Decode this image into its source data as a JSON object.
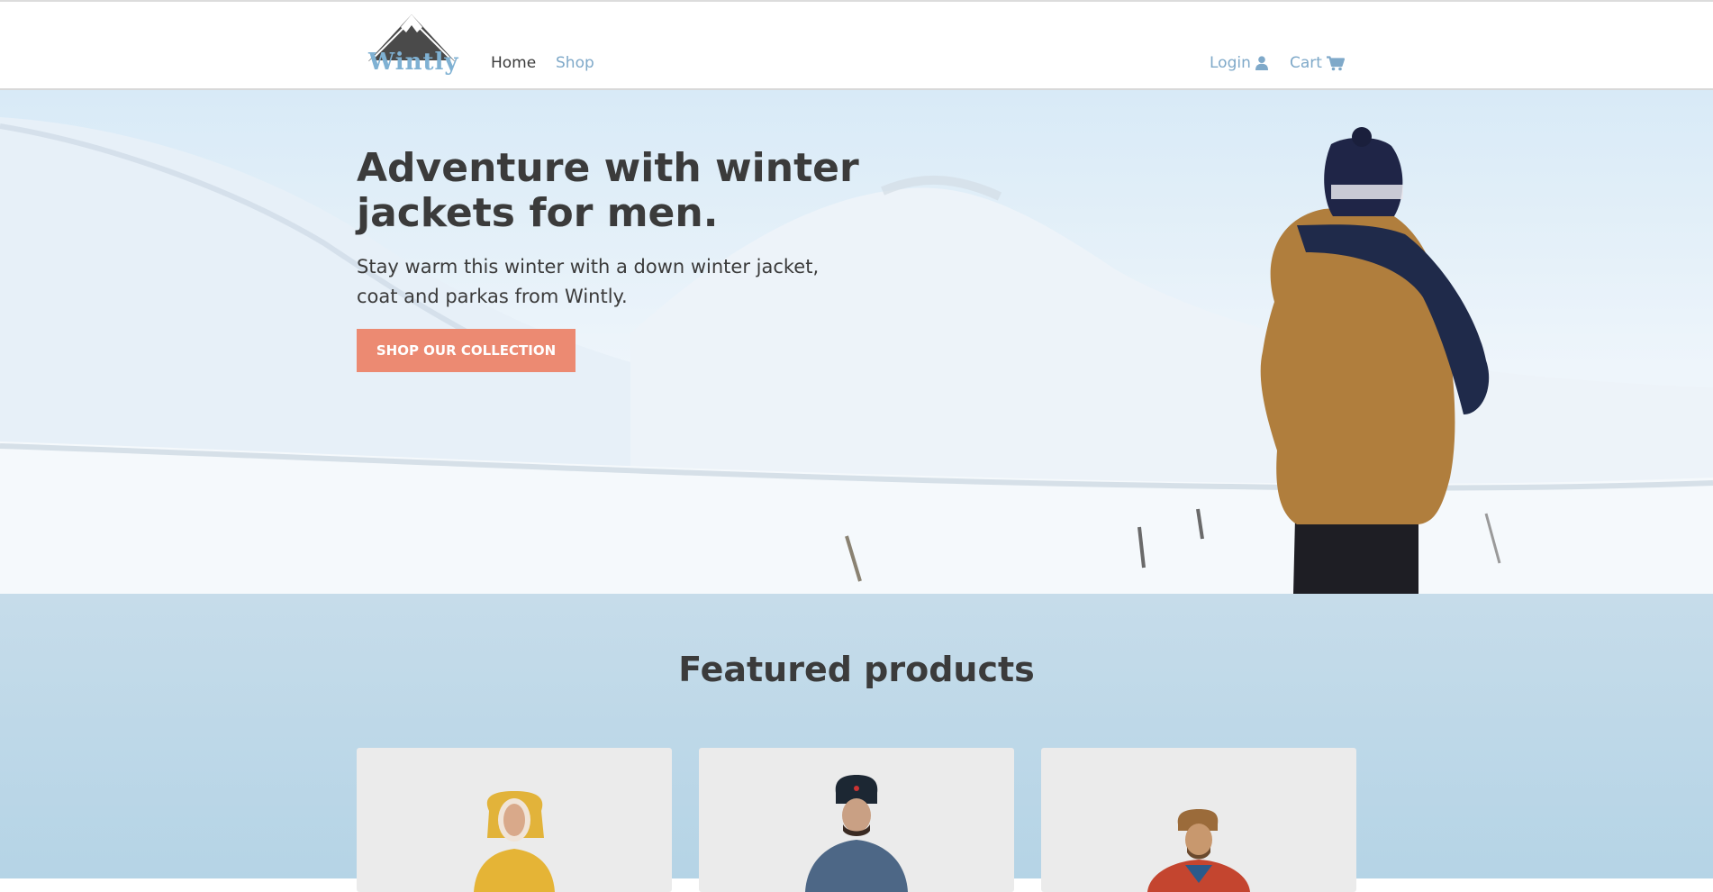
{
  "brand": {
    "name": "Wintly"
  },
  "nav": {
    "home": "Home",
    "shop": "Shop",
    "login": "Login",
    "cart": "Cart"
  },
  "icons": {
    "login": "user-icon",
    "cart": "shopping-cart-icon"
  },
  "hero": {
    "title": "Adventure with winter jackets for men.",
    "subtitle": "Stay warm this winter with a down winter jacket, coat and parkas from Wintly.",
    "cta": "SHOP OUR COLLECTION"
  },
  "featured": {
    "title": "Featured products"
  },
  "colors": {
    "accent": "#ec8a72",
    "link": "#7fa9c9",
    "text": "#3b3b3b",
    "featured_bg": "#b5d4e6",
    "card_bg": "#ebebeb"
  }
}
